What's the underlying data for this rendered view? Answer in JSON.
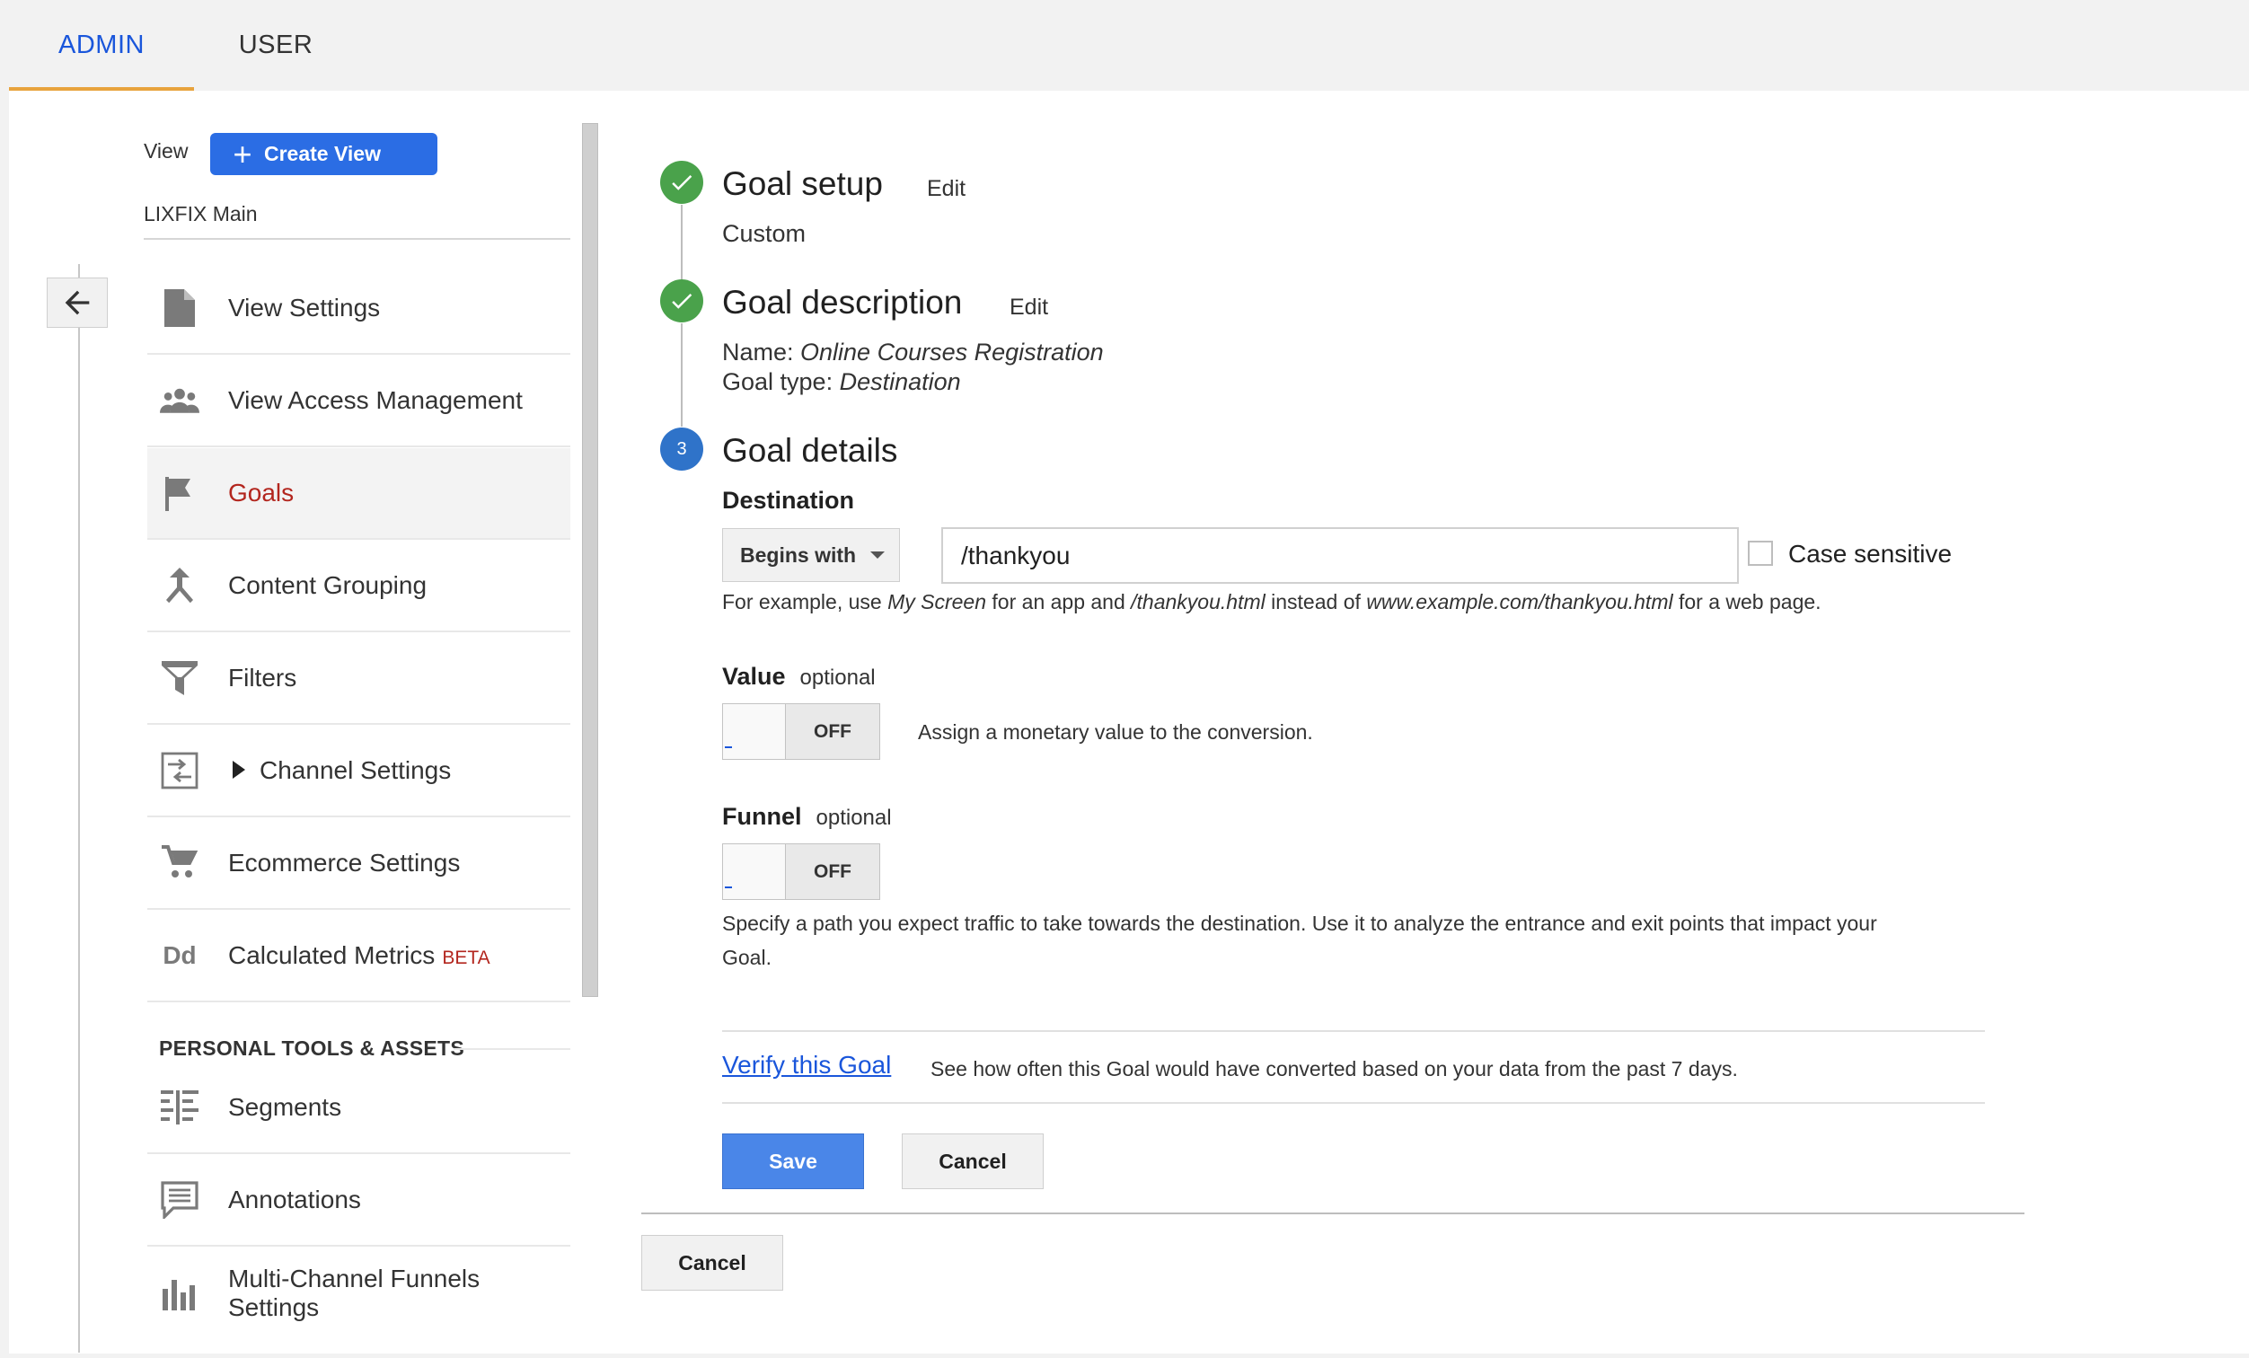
{
  "tabs": {
    "admin": "ADMIN",
    "user": "USER"
  },
  "sidebar": {
    "view_label": "View",
    "create_view": "Create View",
    "view_name": "LIXFIX Main",
    "items": [
      {
        "label": "View Settings",
        "icon": "document-icon"
      },
      {
        "label": "View Access Management",
        "icon": "people-icon"
      },
      {
        "label": "Goals",
        "icon": "flag-icon"
      },
      {
        "label": "Content Grouping",
        "icon": "merge-icon"
      },
      {
        "label": "Filters",
        "icon": "filter-icon"
      },
      {
        "label": "Channel Settings",
        "icon": "channel-icon"
      },
      {
        "label": "Ecommerce Settings",
        "icon": "cart-icon"
      },
      {
        "label": "Calculated Metrics",
        "icon": "dd-icon",
        "badge": "BETA"
      }
    ],
    "section_title": "PERSONAL TOOLS & ASSETS",
    "tools": [
      {
        "label": "Segments",
        "icon": "segments-icon"
      },
      {
        "label": "Annotations",
        "icon": "comment-icon"
      },
      {
        "label": "Multi-Channel Funnels",
        "label2": "Settings",
        "icon": "bar-chart-icon"
      }
    ]
  },
  "goal": {
    "setup": {
      "title": "Goal setup",
      "edit": "Edit",
      "value": "Custom"
    },
    "description": {
      "title": "Goal description",
      "edit": "Edit",
      "name_label": "Name: ",
      "name_value": "Online Courses Registration",
      "type_label": "Goal type: ",
      "type_value": "Destination"
    },
    "details": {
      "step_number": "3",
      "title": "Goal details",
      "destination_label": "Destination",
      "match_type": "Begins with",
      "destination_value": "/thankyou",
      "case_sensitive": "Case sensitive",
      "hint": {
        "p1": "For example, use ",
        "i1": "My Screen",
        "p2": " for an app and ",
        "i2": "/thankyou.html",
        "p3": " instead of ",
        "i3": "www.example.com/thankyou.html",
        "p4": " for a web page."
      },
      "value_label": "Value",
      "value_optional": "optional",
      "value_toggle": "OFF",
      "value_desc": "Assign a monetary value to the conversion.",
      "funnel_label": "Funnel",
      "funnel_optional": "optional",
      "funnel_toggle": "OFF",
      "funnel_desc_1": "Specify a path you expect traffic to take towards the destination. Use it to analyze the entrance and exit points that impact your",
      "funnel_desc_2": "Goal.",
      "verify_link": "Verify this Goal",
      "verify_desc": "See how often this Goal would have converted based on your data from the past 7 days.",
      "save": "Save",
      "cancel": "Cancel"
    },
    "outer_cancel": "Cancel"
  },
  "colors": {
    "accent": "#2b6de4",
    "tab_underline": "#e8a33d",
    "active_item": "#b3261e",
    "step_done": "#4aa24b",
    "step_current": "#2f73c9"
  }
}
